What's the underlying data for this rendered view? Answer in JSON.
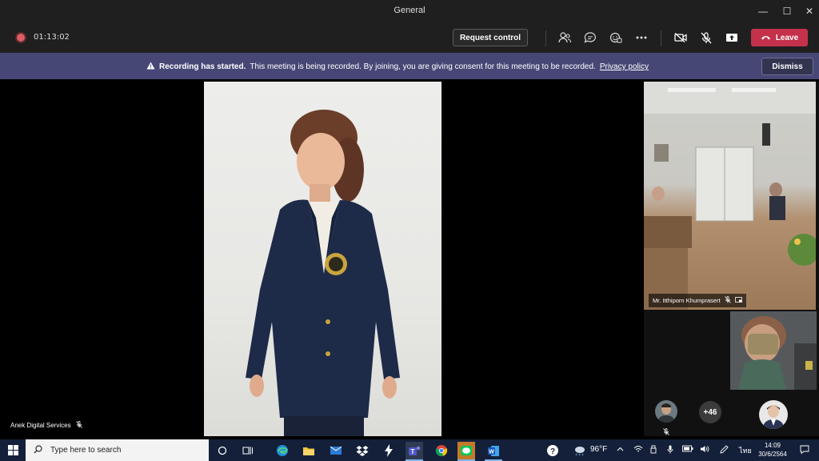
{
  "window": {
    "title": "General",
    "controls": [
      "—",
      "☐",
      "✕"
    ]
  },
  "meeting": {
    "timer": "01:13:02",
    "request_control_label": "Request control",
    "leave_label": "Leave"
  },
  "banner": {
    "title": "Recording has started.",
    "message": "This meeting is being recorded. By joining, you are giving consent for this meeting to be recorded.",
    "link": "Privacy policy",
    "dismiss_label": "Dismiss"
  },
  "stage": {
    "presenter_name": "Anek Digital Services"
  },
  "participants": {
    "featured_name": "Mr. Itthiporn Khumprasert",
    "overflow_count": "+46"
  },
  "taskbar": {
    "search_placeholder": "Type here to search",
    "temperature": "96°F",
    "language": "ไทย",
    "time": "14:09",
    "date": "30/6/2564"
  },
  "colors": {
    "leave": "#c4314b",
    "banner": "#464775",
    "recording_dot": "#e05a64"
  }
}
